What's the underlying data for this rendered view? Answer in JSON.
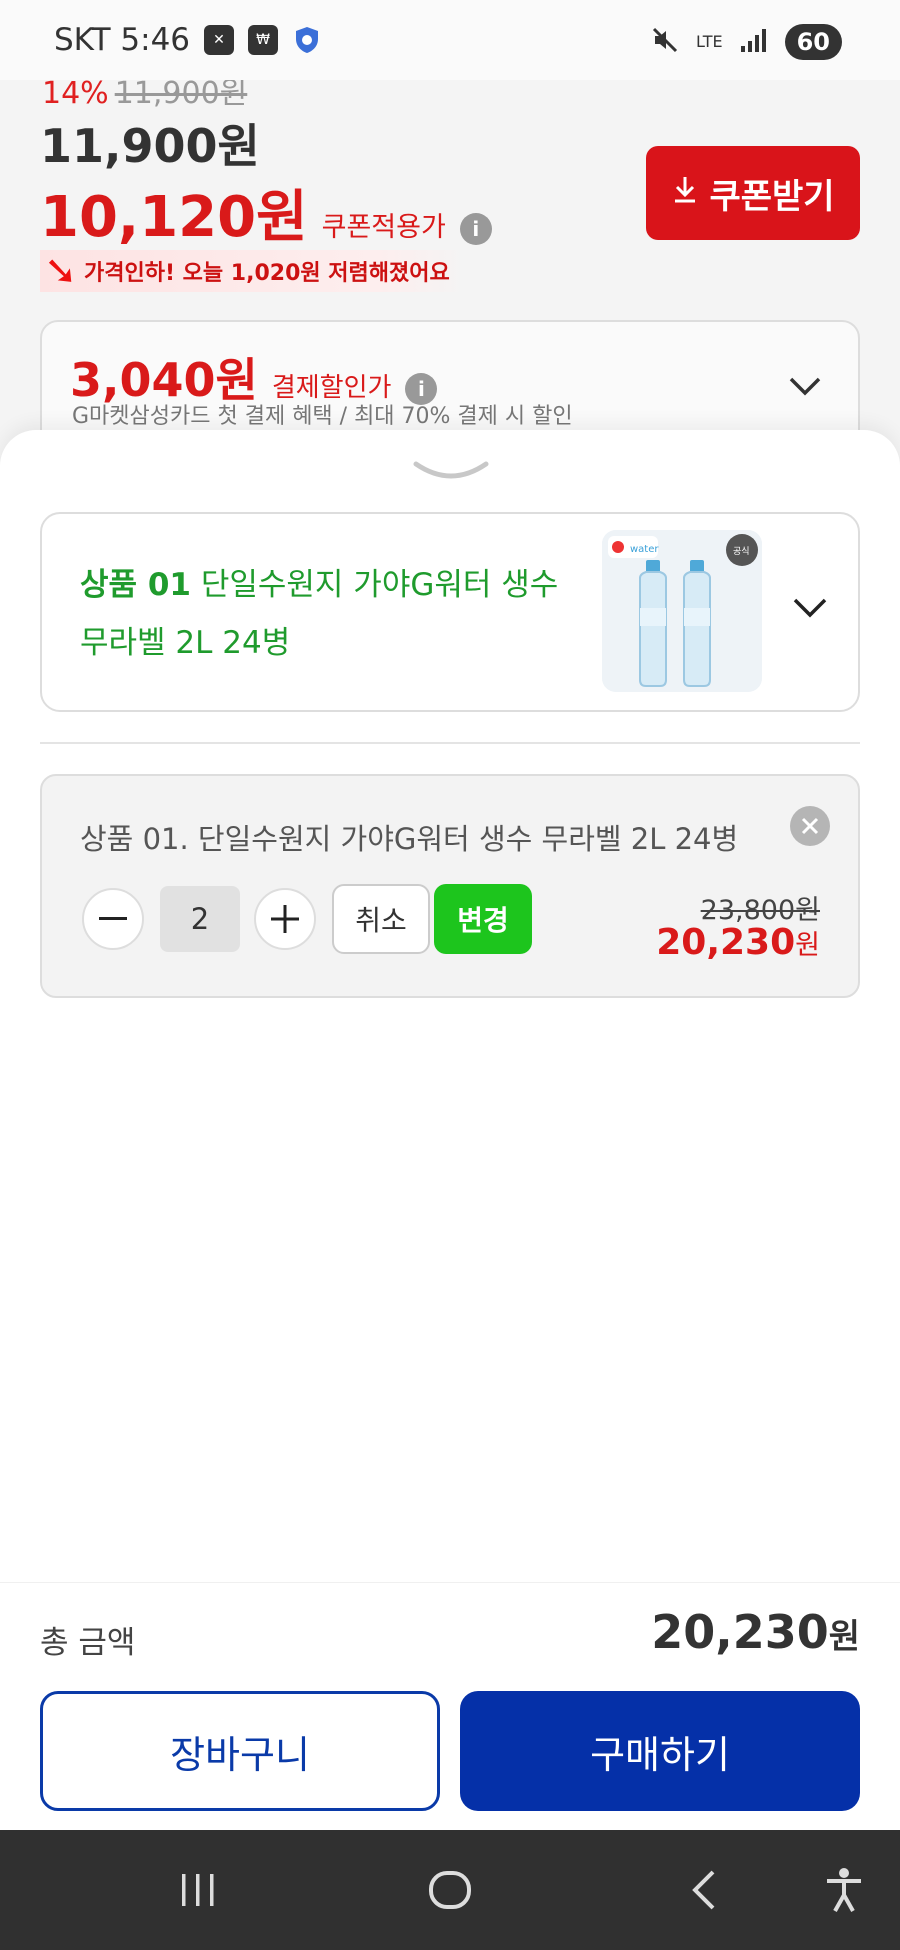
{
  "status_bar": {
    "carrier": "SKT",
    "time": "5:46",
    "network": "LTE",
    "battery": "60",
    "icons": [
      "ad-block-icon",
      "pay-icon",
      "shield-icon",
      "mute-icon",
      "signal-icon"
    ]
  },
  "product": {
    "discount_rate": "14%",
    "discount_original": "11,900원",
    "price": "11,900원",
    "coupon_price": "10,120원",
    "coupon_price_label": "쿠폰적용가",
    "price_drop_text": "가격인하! 오늘 1,020원 저렴해졌어요",
    "coupon_button": "쿠폰받기",
    "payment_price": "3,040원",
    "payment_price_label": "결제할인가",
    "payment_sub": "G마켓삼성카드 첫 결제 혜택 / 최대 70% 결제 시 할인"
  },
  "option_select": {
    "number": "상품 01",
    "name": "단일수원지 가야G워터 생수 무라벨 2L 24병",
    "thumbnail_badge": "공식"
  },
  "selected_item": {
    "name": "상품 01. 단일수원지 가야G워터 생수 무라벨 2L 24병",
    "quantity": "2",
    "cancel_label": "취소",
    "change_label": "변경",
    "original_price": "23,800원",
    "price": "20,230",
    "price_unit": "원"
  },
  "footer": {
    "total_label": "총 금액",
    "total_value": "20,230",
    "total_unit": "원",
    "cart_label": "장바구니",
    "buy_label": "구매하기"
  },
  "colors": {
    "accent_red": "#d91a1a",
    "option_green": "#1f9b2d",
    "change_green": "#1dc51d",
    "buy_blue": "#0530a8"
  }
}
